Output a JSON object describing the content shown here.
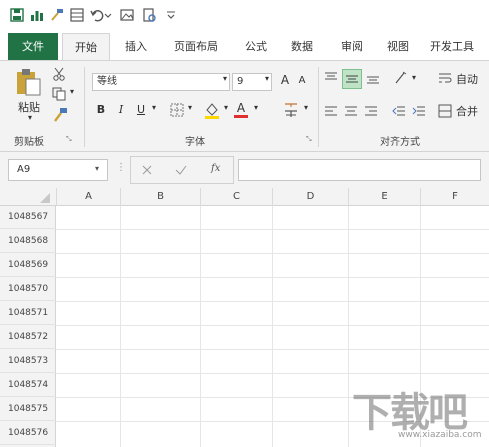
{
  "ribbon": {
    "tabs": [
      {
        "label": "文件"
      },
      {
        "label": "开始"
      },
      {
        "label": "插入"
      },
      {
        "label": "页面布局"
      },
      {
        "label": "公式"
      },
      {
        "label": "数据"
      },
      {
        "label": "审阅"
      },
      {
        "label": "视图"
      },
      {
        "label": "开发工具"
      }
    ],
    "clipboard": {
      "paste": "粘贴",
      "group": "剪贴板"
    },
    "font": {
      "name": "等线",
      "size": "9",
      "bold": "B",
      "italic": "I",
      "underline": "U",
      "grow": "A",
      "shrink": "A",
      "color_a": "A",
      "group": "字体"
    },
    "alignment": {
      "wrap": "自动",
      "merge": "合并",
      "group": "对齐方式"
    }
  },
  "formula_bar": {
    "name_box": "A9",
    "fx": "fx"
  },
  "sheet": {
    "columns": [
      "A",
      "B",
      "C",
      "D",
      "E",
      "F"
    ],
    "rows": [
      "1048567",
      "1048568",
      "1048569",
      "1048570",
      "1048571",
      "1048572",
      "1048573",
      "1048574",
      "1048575",
      "1048576"
    ]
  },
  "watermark": {
    "text": "下载吧",
    "url": "www.xiazaiba.com"
  },
  "colors": {
    "excel_green": "#217346",
    "ribbon_bg": "#f3f3f3"
  }
}
